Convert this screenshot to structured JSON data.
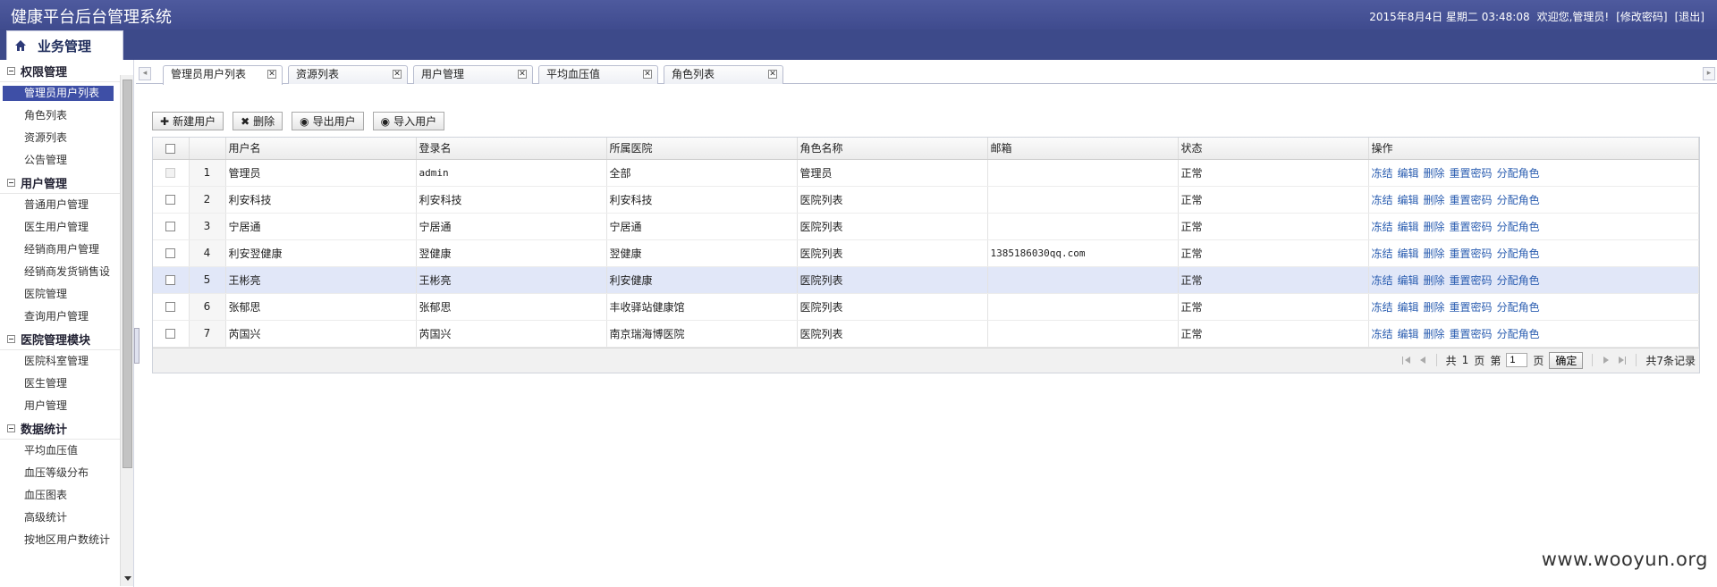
{
  "header": {
    "title": "健康平台后台管理系统",
    "datetime": "2015年8月4日 星期二 03:48:08",
    "welcome": "欢迎您,管理员!",
    "change_pwd": "[修改密码]",
    "logout": "[退出]"
  },
  "sidebar": {
    "head": "业务管理",
    "groups": [
      {
        "title": "权限管理",
        "items": [
          "管理员用户列表",
          "角色列表",
          "资源列表",
          "公告管理"
        ]
      },
      {
        "title": "用户管理",
        "items": [
          "普通用户管理",
          "医生用户管理",
          "经销商用户管理",
          "经销商发货销售设",
          "医院管理",
          "查询用户管理"
        ]
      },
      {
        "title": "医院管理模块",
        "items": [
          "医院科室管理",
          "医生管理",
          "用户管理"
        ]
      },
      {
        "title": "数据统计",
        "items": [
          "平均血压值",
          "血压等级分布",
          "血压图表",
          "高级统计",
          "按地区用户数统计"
        ]
      }
    ],
    "active_item": "管理员用户列表"
  },
  "tabs": [
    {
      "label": "管理员用户列表",
      "close": "✕"
    },
    {
      "label": "资源列表",
      "close": "✕"
    },
    {
      "label": "用户管理",
      "close": "✕"
    },
    {
      "label": "平均血压值",
      "close": "✕"
    },
    {
      "label": "角色列表",
      "close": "✕"
    }
  ],
  "toolbar": {
    "new_user": "新建用户",
    "delete": "删除",
    "export_user": "导出用户",
    "import_user": "导入用户"
  },
  "table": {
    "columns": [
      "用户名",
      "登录名",
      "所属医院",
      "角色名称",
      "邮箱",
      "状态",
      "操作"
    ],
    "rows": [
      {
        "num": "1",
        "username": "管理员",
        "login": "admin",
        "hospital": "全部",
        "role": "管理员",
        "email": "",
        "status": "正常"
      },
      {
        "num": "2",
        "username": "利安科技",
        "login": "利安科技",
        "hospital": "利安科技",
        "role": "医院列表",
        "email": "",
        "status": "正常"
      },
      {
        "num": "3",
        "username": "宁居通",
        "login": "宁居通",
        "hospital": "宁居通",
        "role": "医院列表",
        "email": "",
        "status": "正常"
      },
      {
        "num": "4",
        "username": "利安翌健康",
        "login": "翌健康",
        "hospital": "翌健康",
        "role": "医院列表",
        "email": "1385186030qq.com",
        "status": "正常"
      },
      {
        "num": "5",
        "username": "王彬亮",
        "login": "王彬亮",
        "hospital": "利安健康",
        "role": "医院列表",
        "email": "",
        "status": "正常"
      },
      {
        "num": "6",
        "username": "张郁思",
        "login": "张郁思",
        "hospital": "丰收驿站健康馆",
        "role": "医院列表",
        "email": "",
        "status": "正常"
      },
      {
        "num": "7",
        "username": "芮国兴",
        "login": "芮国兴",
        "hospital": "南京瑞海博医院",
        "role": "医院列表",
        "email": "",
        "status": "正常"
      }
    ],
    "actions": [
      "冻结",
      "编辑",
      "删除",
      "重置密码",
      "分配角色"
    ],
    "highlighted_row": 5
  },
  "pager": {
    "total_prefix": "共",
    "total_pages": "1",
    "page_unit": "页",
    "goto_prefix": "第",
    "current_page": "1",
    "goto_suffix": "页",
    "confirm": "确定",
    "records": "共7条记录"
  },
  "watermark": "www.wooyun.org"
}
